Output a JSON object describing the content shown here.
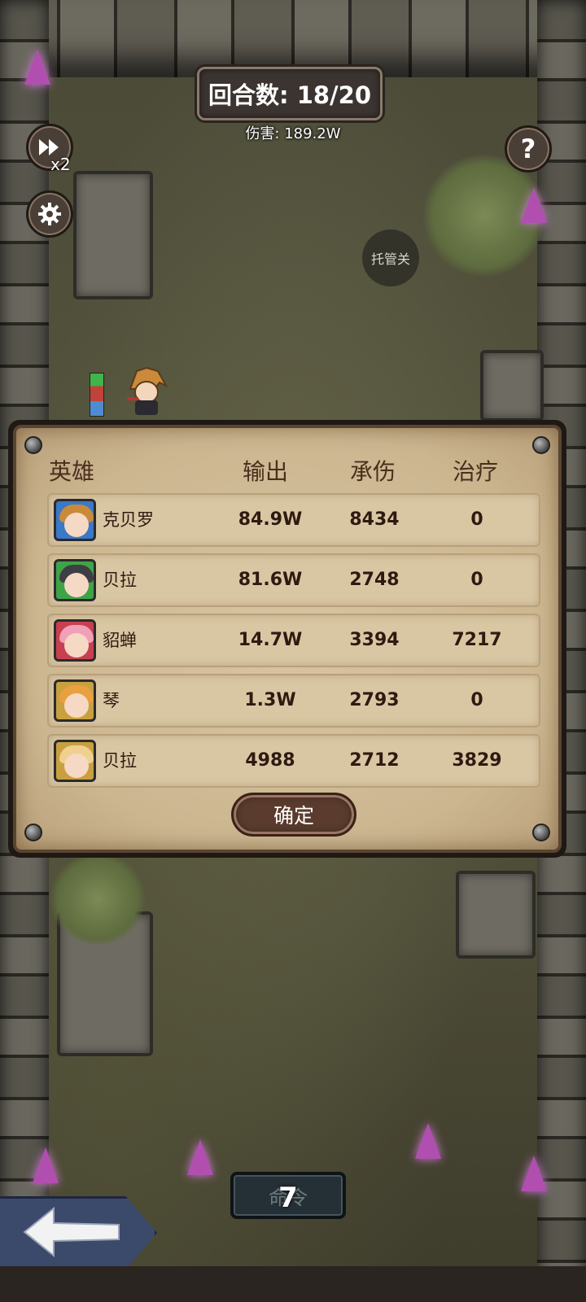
{
  "hud": {
    "round_label": "回合数: 18/20",
    "damage_label": "伤害: 189.2W",
    "speed_label": "x2",
    "auto_label": "托管关",
    "help_label": "?"
  },
  "stats_panel": {
    "headers": {
      "hero": "英雄",
      "output": "输出",
      "taken": "承伤",
      "heal": "治疗"
    },
    "rows": [
      {
        "name": "克贝罗",
        "output": "84.9W",
        "taken": "8434",
        "heal": "0",
        "frame_color": "#3a78c8",
        "hair_color": "#c98a3a"
      },
      {
        "name": "贝拉",
        "output": "81.6W",
        "taken": "2748",
        "heal": "0",
        "frame_color": "#3fa447",
        "hair_color": "#3e3e46"
      },
      {
        "name": "貂蝉",
        "output": "14.7W",
        "taken": "3394",
        "heal": "7217",
        "frame_color": "#c84050",
        "hair_color": "#f2a0b8"
      },
      {
        "name": "琴",
        "output": "1.3W",
        "taken": "2793",
        "heal": "0",
        "frame_color": "#c8a040",
        "hair_color": "#e8a040"
      },
      {
        "name": "贝拉",
        "output": "4988",
        "taken": "2712",
        "heal": "3829",
        "frame_color": "#c8a040",
        "hair_color": "#f0d090"
      }
    ],
    "confirm_label": "确定"
  },
  "bottom": {
    "command_label": "命令",
    "command_count": "7"
  },
  "colors": {
    "panel_bg": "#cbb690",
    "text_dark": "#2e1a10",
    "button_brown": "#5a3b2d"
  }
}
